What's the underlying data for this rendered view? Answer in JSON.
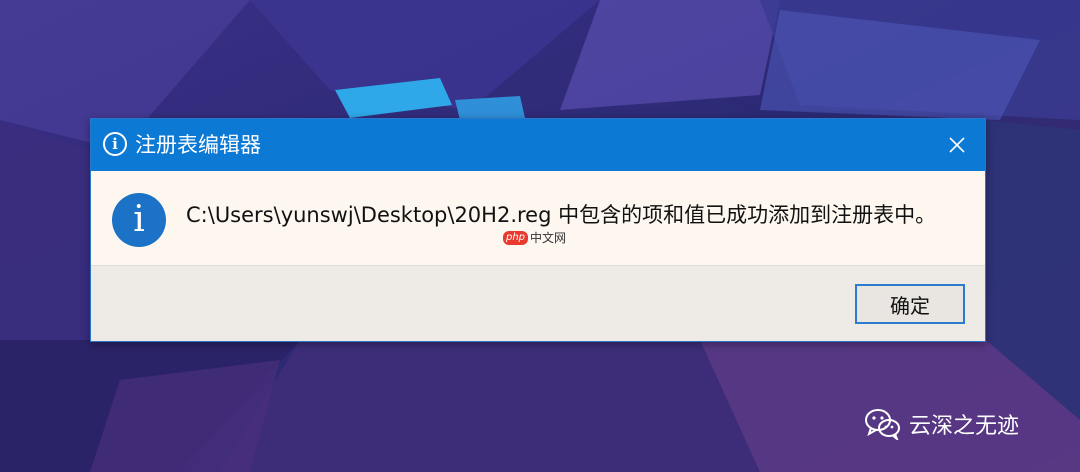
{
  "dialog": {
    "title": "注册表编辑器",
    "title_icon": "info-icon",
    "close_icon": "close-icon",
    "message": "C:\\Users\\yunswj\\Desktop\\20H2.reg 中包含的项和值已成功添加到注册表中。",
    "message_icon": "info-icon",
    "ok_label": "确定"
  },
  "overlay": {
    "php_badge": "php",
    "php_text": "中文网",
    "wechat_icon": "wechat-icon",
    "wechat_text": "云深之无迹"
  },
  "colors": {
    "titlebar": "#0c79d4",
    "info_icon": "#1b72c6",
    "dialog_bg": "#fdf7f0",
    "footer_bg": "#eeeae6",
    "button_border": "#2b7bd0"
  }
}
